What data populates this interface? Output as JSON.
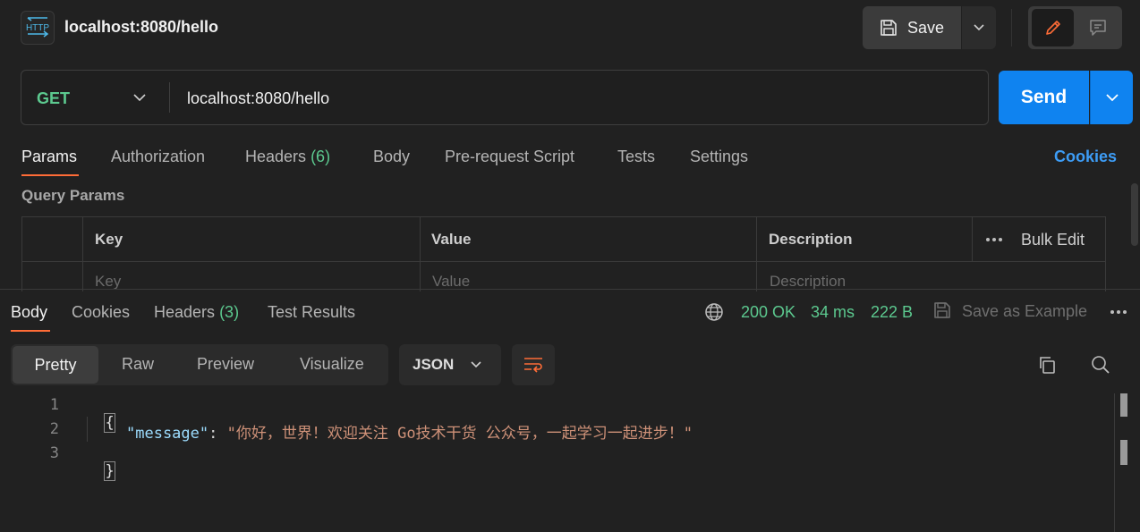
{
  "header": {
    "app_icon_text": "HTTP",
    "title": "localhost:8080/hello",
    "save_label": "Save"
  },
  "request": {
    "method": "GET",
    "url": "localhost:8080/hello",
    "send_label": "Send"
  },
  "request_tabs": {
    "params": "Params",
    "authorization": "Authorization",
    "headers": "Headers",
    "headers_count": "(6)",
    "body": "Body",
    "pre_request": "Pre-request Script",
    "tests": "Tests",
    "settings": "Settings",
    "cookies": "Cookies"
  },
  "query_params": {
    "title": "Query Params",
    "columns": {
      "key": "Key",
      "value": "Value",
      "description": "Description"
    },
    "bulk_edit": "Bulk Edit",
    "placeholders": {
      "key": "Key",
      "value": "Value",
      "description": "Description"
    }
  },
  "response_tabs": {
    "body": "Body",
    "cookies": "Cookies",
    "headers": "Headers",
    "headers_count": "(3)",
    "test_results": "Test Results"
  },
  "response_status": {
    "code": "200 OK",
    "time": "34 ms",
    "size": "222 B",
    "save_example": "Save as Example"
  },
  "response_view": {
    "pretty": "Pretty",
    "raw": "Raw",
    "preview": "Preview",
    "visualize": "Visualize",
    "format": "JSON"
  },
  "response_body": {
    "line_numbers": [
      "1",
      "2",
      "3"
    ],
    "open_brace": "{",
    "key": "\"message\"",
    "colon": ": ",
    "value": "\"你好，世界！欢迎关注 Go技术干货 公众号，一起学习一起进步！\"",
    "close_brace": "}"
  },
  "colors": {
    "accent_tab": "#ff6c37",
    "send_button": "#0f83f0",
    "success": "#5cc98f",
    "link": "#3d9cf5"
  }
}
